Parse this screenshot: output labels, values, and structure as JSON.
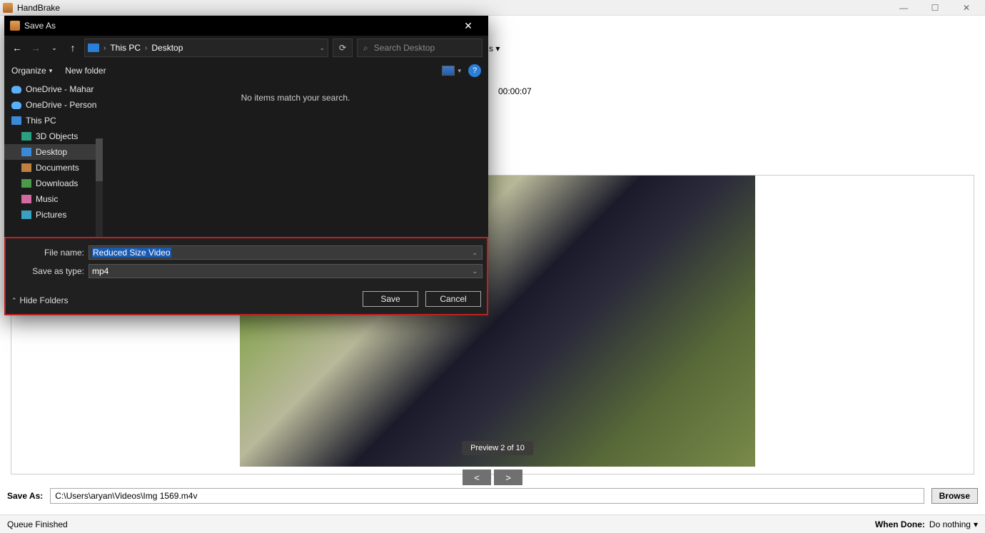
{
  "app": {
    "title": "HandBrake"
  },
  "win_controls": {
    "min": "—",
    "max": "☐",
    "close": "✕"
  },
  "under": {
    "duration_label": "00:00:07",
    "preview_badge": "Preview 2 of 10",
    "prev": "<",
    "next": ">",
    "ang_suffix": "s ▾"
  },
  "save_as_row": {
    "label": "Save As:",
    "path": "C:\\Users\\aryan\\Videos\\Img 1569.m4v",
    "browse": "Browse"
  },
  "status": {
    "left": "Queue Finished",
    "when_done_label": "When Done:",
    "when_done_value": "Do nothing"
  },
  "dialog": {
    "title": "Save As",
    "breadcrumbs": [
      "This PC",
      "Desktop"
    ],
    "search_placeholder": "Search Desktop",
    "toolbar": {
      "organize": "Organize",
      "new_folder": "New folder"
    },
    "tree": [
      {
        "icon": "cloud",
        "label": "OneDrive - Mahar",
        "name": "tree-onedrive-1"
      },
      {
        "icon": "cloud",
        "label": "OneDrive - Person",
        "name": "tree-onedrive-2"
      },
      {
        "icon": "pc",
        "label": "This PC",
        "name": "tree-this-pc"
      },
      {
        "icon": "obj3d",
        "label": "3D Objects",
        "name": "tree-3d-objects",
        "indent": true
      },
      {
        "icon": "desktop",
        "label": "Desktop",
        "name": "tree-desktop",
        "indent": true,
        "selected": true
      },
      {
        "icon": "doc",
        "label": "Documents",
        "name": "tree-documents",
        "indent": true
      },
      {
        "icon": "dl",
        "label": "Downloads",
        "name": "tree-downloads",
        "indent": true
      },
      {
        "icon": "music",
        "label": "Music",
        "name": "tree-music",
        "indent": true
      },
      {
        "icon": "pic",
        "label": "Pictures",
        "name": "tree-pictures",
        "indent": true
      }
    ],
    "empty_msg": "No items match your search.",
    "file_name_label": "File name:",
    "file_name_value": "Reduced Size Video",
    "save_type_label": "Save as type:",
    "save_type_value": "mp4",
    "save_btn": "Save",
    "cancel_btn": "Cancel",
    "hide_folders": "Hide Folders"
  }
}
